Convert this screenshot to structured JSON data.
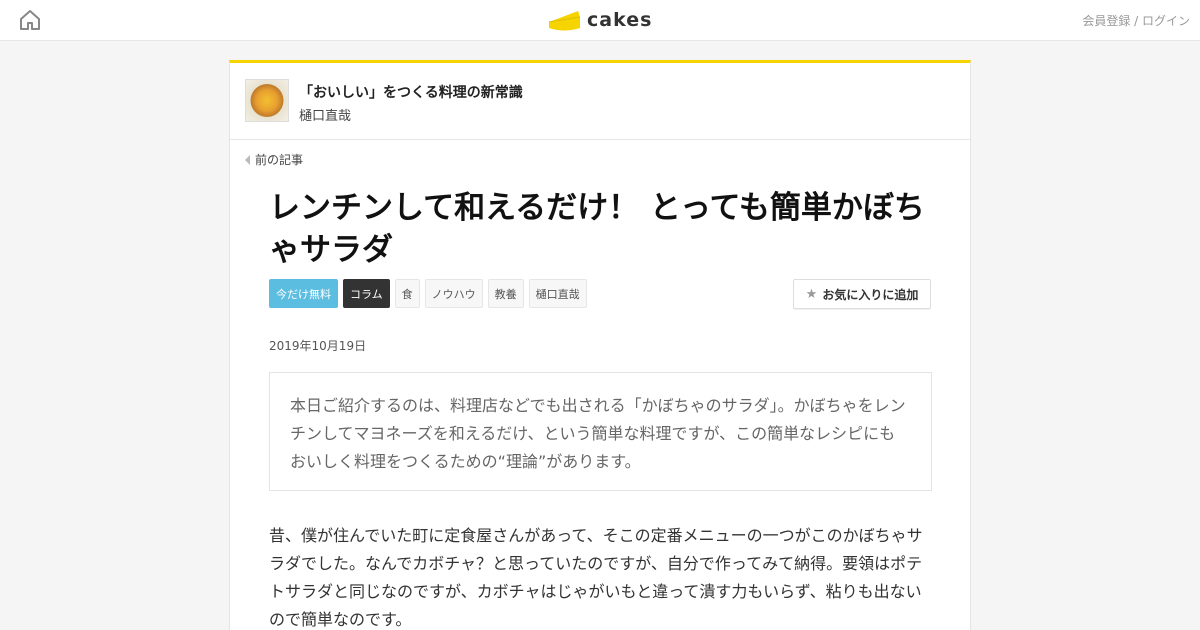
{
  "header": {
    "logo_text": "cakes",
    "auth_link": "会員登録 / ログイン",
    "brand_color": "#f5d400"
  },
  "series": {
    "title": "「おいしい」をつくる料理の新常識",
    "author": "樋口直哉"
  },
  "nav": {
    "prev_label": "前の記事"
  },
  "article": {
    "title": "レンチンして和えるだけ！ とっても簡単かぼちゃサラダ",
    "tags": [
      "今だけ無料",
      "コラム",
      "食",
      "ノウハウ",
      "教養",
      "樋口直哉"
    ],
    "favorite_label": "お気に入りに追加",
    "date": "2019年10月19日",
    "lead": "本日ご紹介するのは、料理店などでも出される「かぼちゃのサラダ」。かぼちゃをレンチンしてマヨネーズを和えるだけ、という簡単な料理ですが、この簡単なレシピにもおいしく料理をつくるための“理論”があります。",
    "body": "昔、僕が住んでいた町に定食屋さんがあって、そこの定番メニューの一つがこのかぼちゃサラダでした。なんでカボチャ？と思っていたのですが、自分で作ってみて納得。要領はポテトサラダと同じなのですが、カボチャはじゃがいもと違って潰す力もいらず、粘りも出ないので簡単なのです。"
  }
}
